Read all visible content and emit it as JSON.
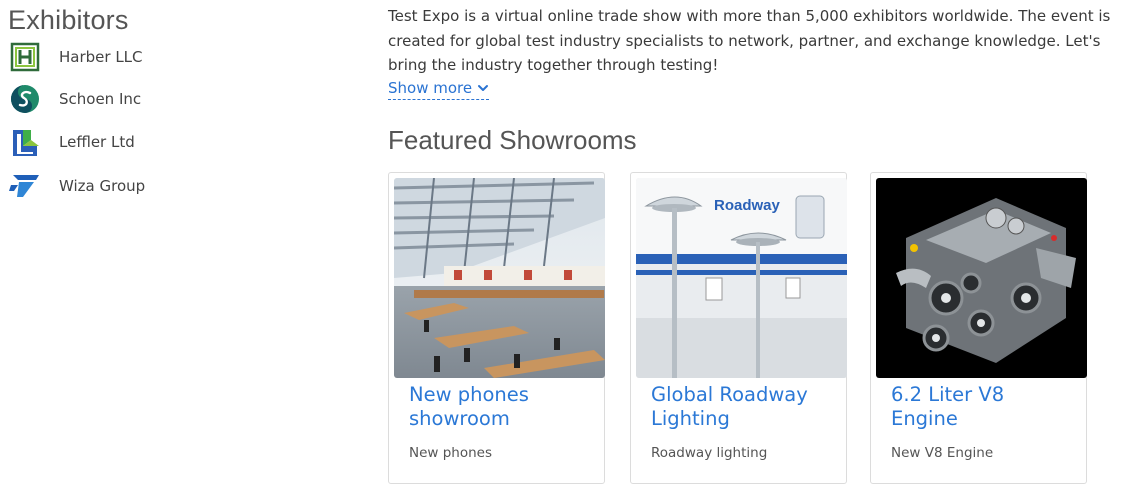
{
  "sidebar": {
    "title": "Exhibitors",
    "items": [
      {
        "label": "Harber LLC",
        "icon": "harber-logo-icon"
      },
      {
        "label": "Schoen Inc",
        "icon": "schoen-logo-icon"
      },
      {
        "label": "Leffler Ltd",
        "icon": "leffler-logo-icon"
      },
      {
        "label": "Wiza Group",
        "icon": "wiza-logo-icon"
      }
    ]
  },
  "main": {
    "description": "Test Expo is a virtual online trade show with more than 5,000 exhibitors worldwide. The event is created for global test industry specialists to network, partner, and exchange knowledge. Let's bring the industry together through testing!",
    "show_more": "Show more",
    "featured_title": "Featured Showrooms",
    "showrooms": [
      {
        "title": "New phones showroom",
        "subtitle": "New phones"
      },
      {
        "title": "Global Roadway Lighting",
        "subtitle": "Roadway lighting",
        "image_text": "Roadway"
      },
      {
        "title": "6.2 Liter V8 Engine",
        "subtitle": "New V8 Engine"
      }
    ]
  },
  "colors": {
    "accent": "#2b78d6",
    "link": "#2a73d2"
  }
}
